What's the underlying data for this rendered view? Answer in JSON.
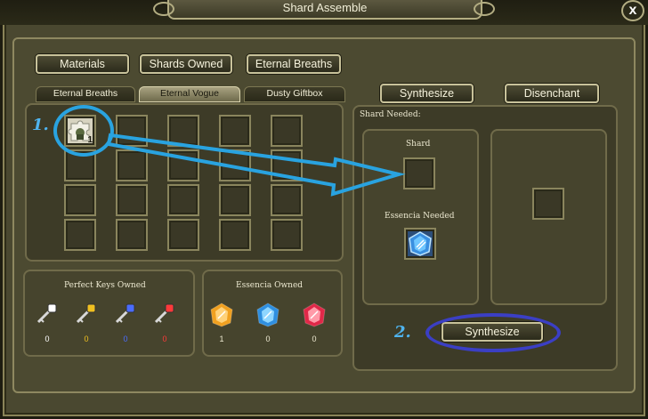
{
  "window": {
    "title": "Shard Assemble",
    "close_label": "x"
  },
  "top_buttons": {
    "materials": "Materials",
    "shards_owned": "Shards Owned",
    "eternal_breaths": "Eternal Breaths"
  },
  "tabs": {
    "eternal_breaths": "Eternal Breaths",
    "eternal_vogue": "Eternal Vogue",
    "dusty_giftbox": "Dusty Giftbox"
  },
  "grid": {
    "first_item_count": "1"
  },
  "keys": {
    "title": "Perfect Keys Owned",
    "items": [
      {
        "count": "0",
        "color": "#ffffff"
      },
      {
        "count": "0",
        "color": "#f0c020"
      },
      {
        "count": "0",
        "color": "#4a6cff"
      },
      {
        "count": "0",
        "color": "#ff3a3a"
      }
    ]
  },
  "essencia": {
    "title": "Essencia Owned",
    "items": [
      {
        "count": "1"
      },
      {
        "count": "0"
      },
      {
        "count": "0"
      }
    ]
  },
  "right": {
    "synthesize_tab": "Synthesize",
    "disenchant_tab": "Disenchant",
    "shard_needed": "Shard Needed:",
    "shard_label": "Shard",
    "essencia_needed": "Essencia Needed",
    "synthesize_button": "Synthesize"
  },
  "annotations": {
    "step1": "1.",
    "step2": "2.",
    "color": "#29a3e0",
    "step2_color": "#3b3fc4"
  }
}
